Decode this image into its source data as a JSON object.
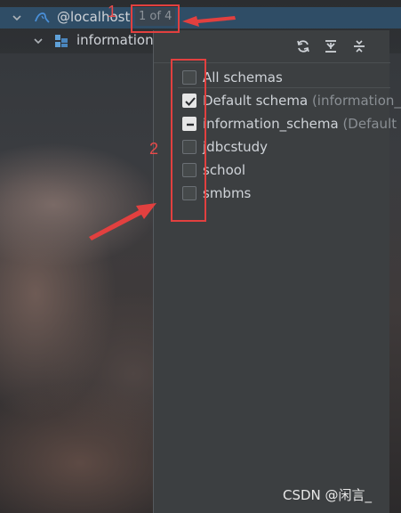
{
  "tree": {
    "root_label": "@localhost",
    "root_badge": "1 of 4",
    "child_label": "information"
  },
  "annotations": {
    "marker_1": "1",
    "marker_2": "2"
  },
  "popup": {
    "toolbar": {
      "refresh_icon": "refresh-icon",
      "expand_all_icon": "expand-all-icon",
      "collapse_all_icon": "collapse-all-icon"
    },
    "items": [
      {
        "label": "All schemas",
        "hint": "",
        "state": "unchecked"
      },
      {
        "label": "Default schema",
        "hint": " (information_",
        "state": "checked"
      },
      {
        "label": "information_schema",
        "hint": " (Default",
        "state": "indeterminate"
      },
      {
        "label": "jdbcstudy",
        "hint": "",
        "state": "unchecked"
      },
      {
        "label": "school",
        "hint": "",
        "state": "unchecked"
      },
      {
        "label": "smbms",
        "hint": "",
        "state": "unchecked"
      }
    ]
  },
  "watermark": "CSDN @闲言_",
  "colors": {
    "selection": "#2f4d66",
    "annotation_red": "#e2403f",
    "popup_bg": "#3c3f41"
  }
}
